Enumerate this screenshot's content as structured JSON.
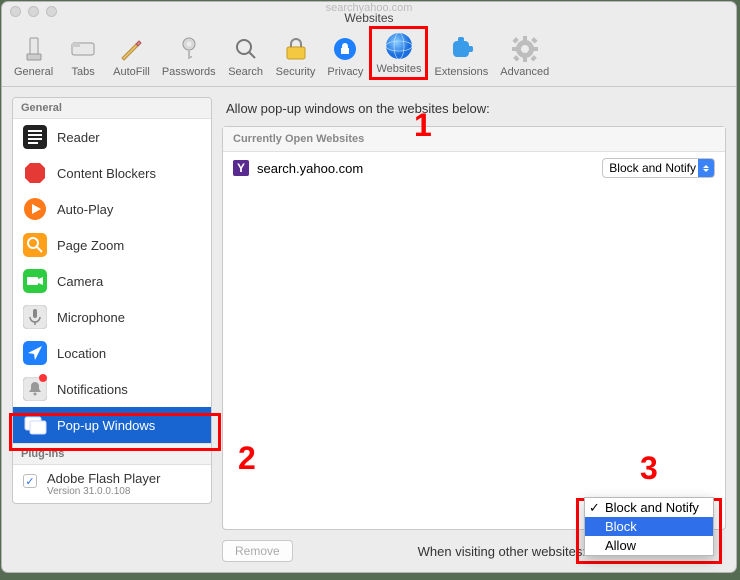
{
  "window": {
    "subtitle_truncated": "searchyahoo.com",
    "title": "Websites"
  },
  "toolbar": [
    {
      "id": "general",
      "label": "General"
    },
    {
      "id": "tabs",
      "label": "Tabs"
    },
    {
      "id": "autofill",
      "label": "AutoFill"
    },
    {
      "id": "passwords",
      "label": "Passwords"
    },
    {
      "id": "search",
      "label": "Search"
    },
    {
      "id": "security",
      "label": "Security"
    },
    {
      "id": "privacy",
      "label": "Privacy"
    },
    {
      "id": "websites",
      "label": "Websites",
      "selected": true
    },
    {
      "id": "extensions",
      "label": "Extensions"
    },
    {
      "id": "advanced",
      "label": "Advanced"
    }
  ],
  "sidebar": {
    "section_general": "General",
    "items": [
      {
        "id": "reader",
        "label": "Reader"
      },
      {
        "id": "content-blockers",
        "label": "Content Blockers"
      },
      {
        "id": "auto-play",
        "label": "Auto-Play"
      },
      {
        "id": "page-zoom",
        "label": "Page Zoom"
      },
      {
        "id": "camera",
        "label": "Camera"
      },
      {
        "id": "microphone",
        "label": "Microphone"
      },
      {
        "id": "location",
        "label": "Location"
      },
      {
        "id": "notifications",
        "label": "Notifications",
        "badge": true
      },
      {
        "id": "popup-windows",
        "label": "Pop-up Windows",
        "selected": true
      }
    ],
    "section_plugins": "Plug-ins",
    "plugin": {
      "label": "Adobe Flash Player",
      "version": "Version 31.0.0.108",
      "checked": true
    }
  },
  "main": {
    "heading": "Allow pop-up windows on the websites below:",
    "list_header": "Currently Open Websites",
    "rows": [
      {
        "site": "search.yahoo.com",
        "value": "Block and Notify"
      }
    ],
    "remove_label": "Remove",
    "footer_label": "When visiting other websites:",
    "dropdown": {
      "options": [
        "Block and Notify",
        "Block",
        "Allow"
      ],
      "checked": "Block and Notify",
      "highlighted": "Block"
    }
  },
  "annotations": {
    "a1": "1",
    "a2": "2",
    "a3": "3"
  }
}
